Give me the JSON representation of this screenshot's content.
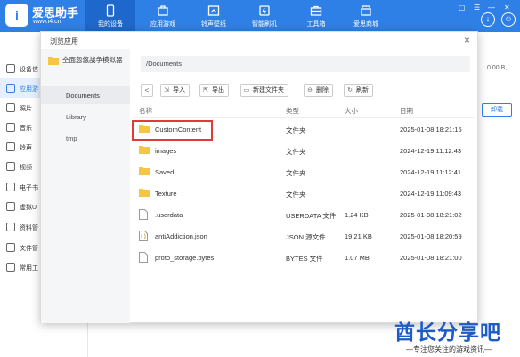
{
  "header": {
    "brand": "爱思助手",
    "brand_url": "www.i4.cn",
    "nav": [
      {
        "label": "我的设备",
        "icon": "phone-icon"
      },
      {
        "label": "应用游戏",
        "icon": "apps-icon"
      },
      {
        "label": "铃声壁纸",
        "icon": "music-icon"
      },
      {
        "label": "智能刷机",
        "icon": "flash-icon"
      },
      {
        "label": "工具箱",
        "icon": "toolbox-icon"
      },
      {
        "label": "爱思商城",
        "icon": "store-icon"
      }
    ]
  },
  "background": {
    "sidebar": [
      "设备信",
      "应用游",
      "照片",
      "音乐",
      "铃声",
      "视频",
      "电子书",
      "虚拟U",
      "资料管",
      "文件管",
      "常用工"
    ],
    "right_label": "0.00 B,",
    "right_button": "卸载"
  },
  "dialog": {
    "title": "浏览应用",
    "close": "×",
    "tree": {
      "root": "全面忽悠战争模拟器",
      "items": [
        "Documents",
        "Library",
        "tmp"
      ]
    },
    "path": "/Documents",
    "toolbar": {
      "back": "<",
      "import": "导入",
      "export": "导出",
      "new_folder": "新建文件夹",
      "delete": "删除",
      "refresh": "刷新"
    },
    "columns": {
      "name": "名称",
      "type": "类型",
      "size": "大小",
      "date": "日期"
    },
    "files": [
      {
        "name": "CustomContent",
        "type": "文件夹",
        "size": "",
        "date": "2025-01-08 18:21:15",
        "kind": "folder"
      },
      {
        "name": "images",
        "type": "文件夹",
        "size": "",
        "date": "2024-12-19 11:12:43",
        "kind": "folder"
      },
      {
        "name": "Saved",
        "type": "文件夹",
        "size": "",
        "date": "2024-12-19 11:12:41",
        "kind": "folder"
      },
      {
        "name": "Texture",
        "type": "文件夹",
        "size": "",
        "date": "2024-12-19 11:09:43",
        "kind": "folder"
      },
      {
        "name": ".userdata",
        "type": "USERDATA 文件",
        "size": "1.24 KB",
        "date": "2025-01-08 18:21:02",
        "kind": "file"
      },
      {
        "name": "antiAddiction.json",
        "type": "JSON 源文件",
        "size": "19.21 KB",
        "date": "2025-01-08 18:20:59",
        "kind": "json"
      },
      {
        "name": "proto_storage.bytes",
        "type": "BYTES 文件",
        "size": "1.07 MB",
        "date": "2025-01-08 18:21:00",
        "kind": "file"
      }
    ]
  },
  "watermark": {
    "title": "酋长分享吧",
    "subtitle": "—专注您关注的游戏资讯—"
  }
}
